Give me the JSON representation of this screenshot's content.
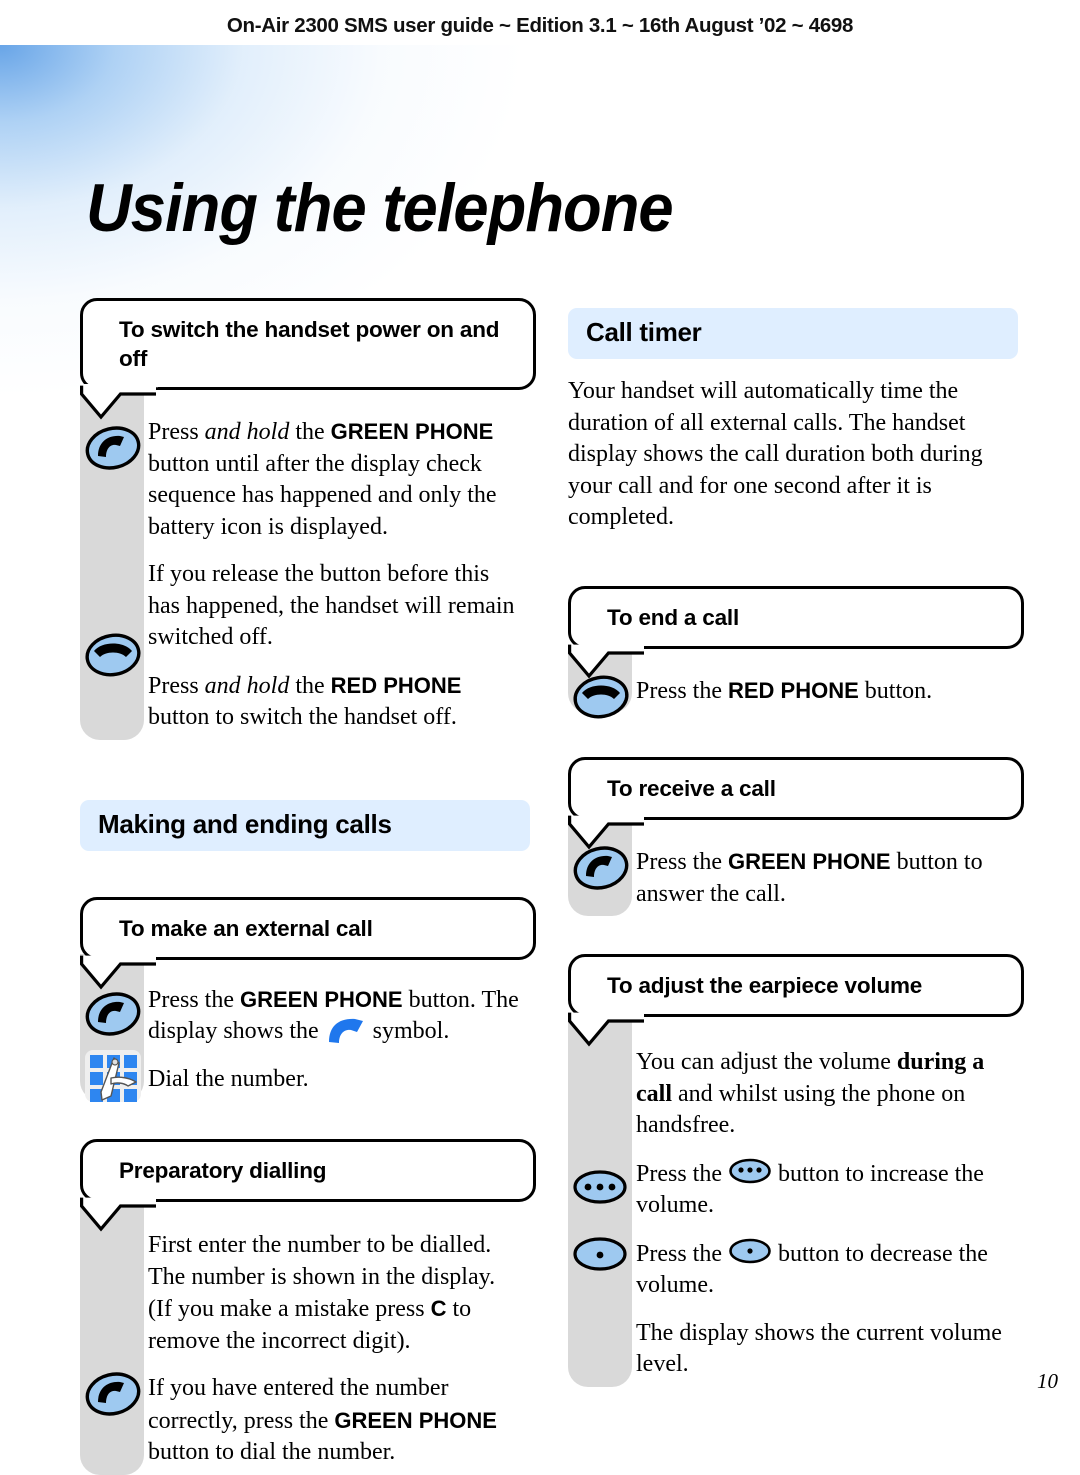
{
  "running_head": "On-Air 2300 SMS user guide ~ Edition 3.1 ~ 16th August ’02 ~ 4698",
  "page_title": "Using the telephone",
  "page_number": "10",
  "colors": {
    "band_blue": "#dfeeff",
    "rail_grey": "#d9d9d9",
    "icon_blue": "#9ec9f0",
    "symbol_blue": "#1f77ed",
    "keypad_blue": "#2e86f0"
  },
  "left_column": {
    "block_power": {
      "heading": "To switch the handset power on and off",
      "icons": [
        "green-phone-icon",
        "red-phone-icon"
      ],
      "paragraphs": [
        "Press and hold the GREEN PHONE button until after the display check sequence has happened and only the battery icon is displayed.",
        "If you release the button before this has happened, the handset will remain switched off.",
        "Press and hold the RED PHONE button to switch the handset off."
      ]
    },
    "section_making": "Making and ending calls",
    "block_external": {
      "heading": "To make an external call",
      "icons": [
        "green-phone-icon",
        "keypad-icon"
      ],
      "paragraphs": [
        "Press the GREEN PHONE button. The display shows the  symbol.",
        "Dial the number."
      ]
    },
    "block_preparatory": {
      "heading": "Preparatory dialling",
      "icons": [
        "green-phone-icon"
      ],
      "paragraphs": [
        "First enter the number to be dialled. The number is shown in the display. (If you make a mistake press C to remove the incorrect digit).",
        "If you have entered the number correctly, press the GREEN PHONE button to dial the number."
      ]
    }
  },
  "right_column": {
    "section_call_timer": "Call timer",
    "call_timer_text": "Your handset will automatically time the duration of all external calls. The handset display shows the call duration both during your call and for one second after it is completed.",
    "block_end_call": {
      "heading": "To end a call",
      "icons": [
        "red-phone-icon"
      ],
      "paragraphs": [
        "Press the RED PHONE button."
      ]
    },
    "block_receive_call": {
      "heading": "To receive a call",
      "icons": [
        "green-phone-icon"
      ],
      "paragraphs": [
        "Press the GREEN PHONE button to answer the call."
      ]
    },
    "block_volume": {
      "heading": "To adjust the earpiece volume",
      "icons": [
        "volume-up-icon",
        "volume-down-icon"
      ],
      "paragraphs": [
        "You can adjust the volume during a call and whilst using the phone on handsfree.",
        "Press the  button to increase the volume.",
        "Press the  button to decrease the volume.",
        "The display shows the current volume level."
      ]
    }
  }
}
